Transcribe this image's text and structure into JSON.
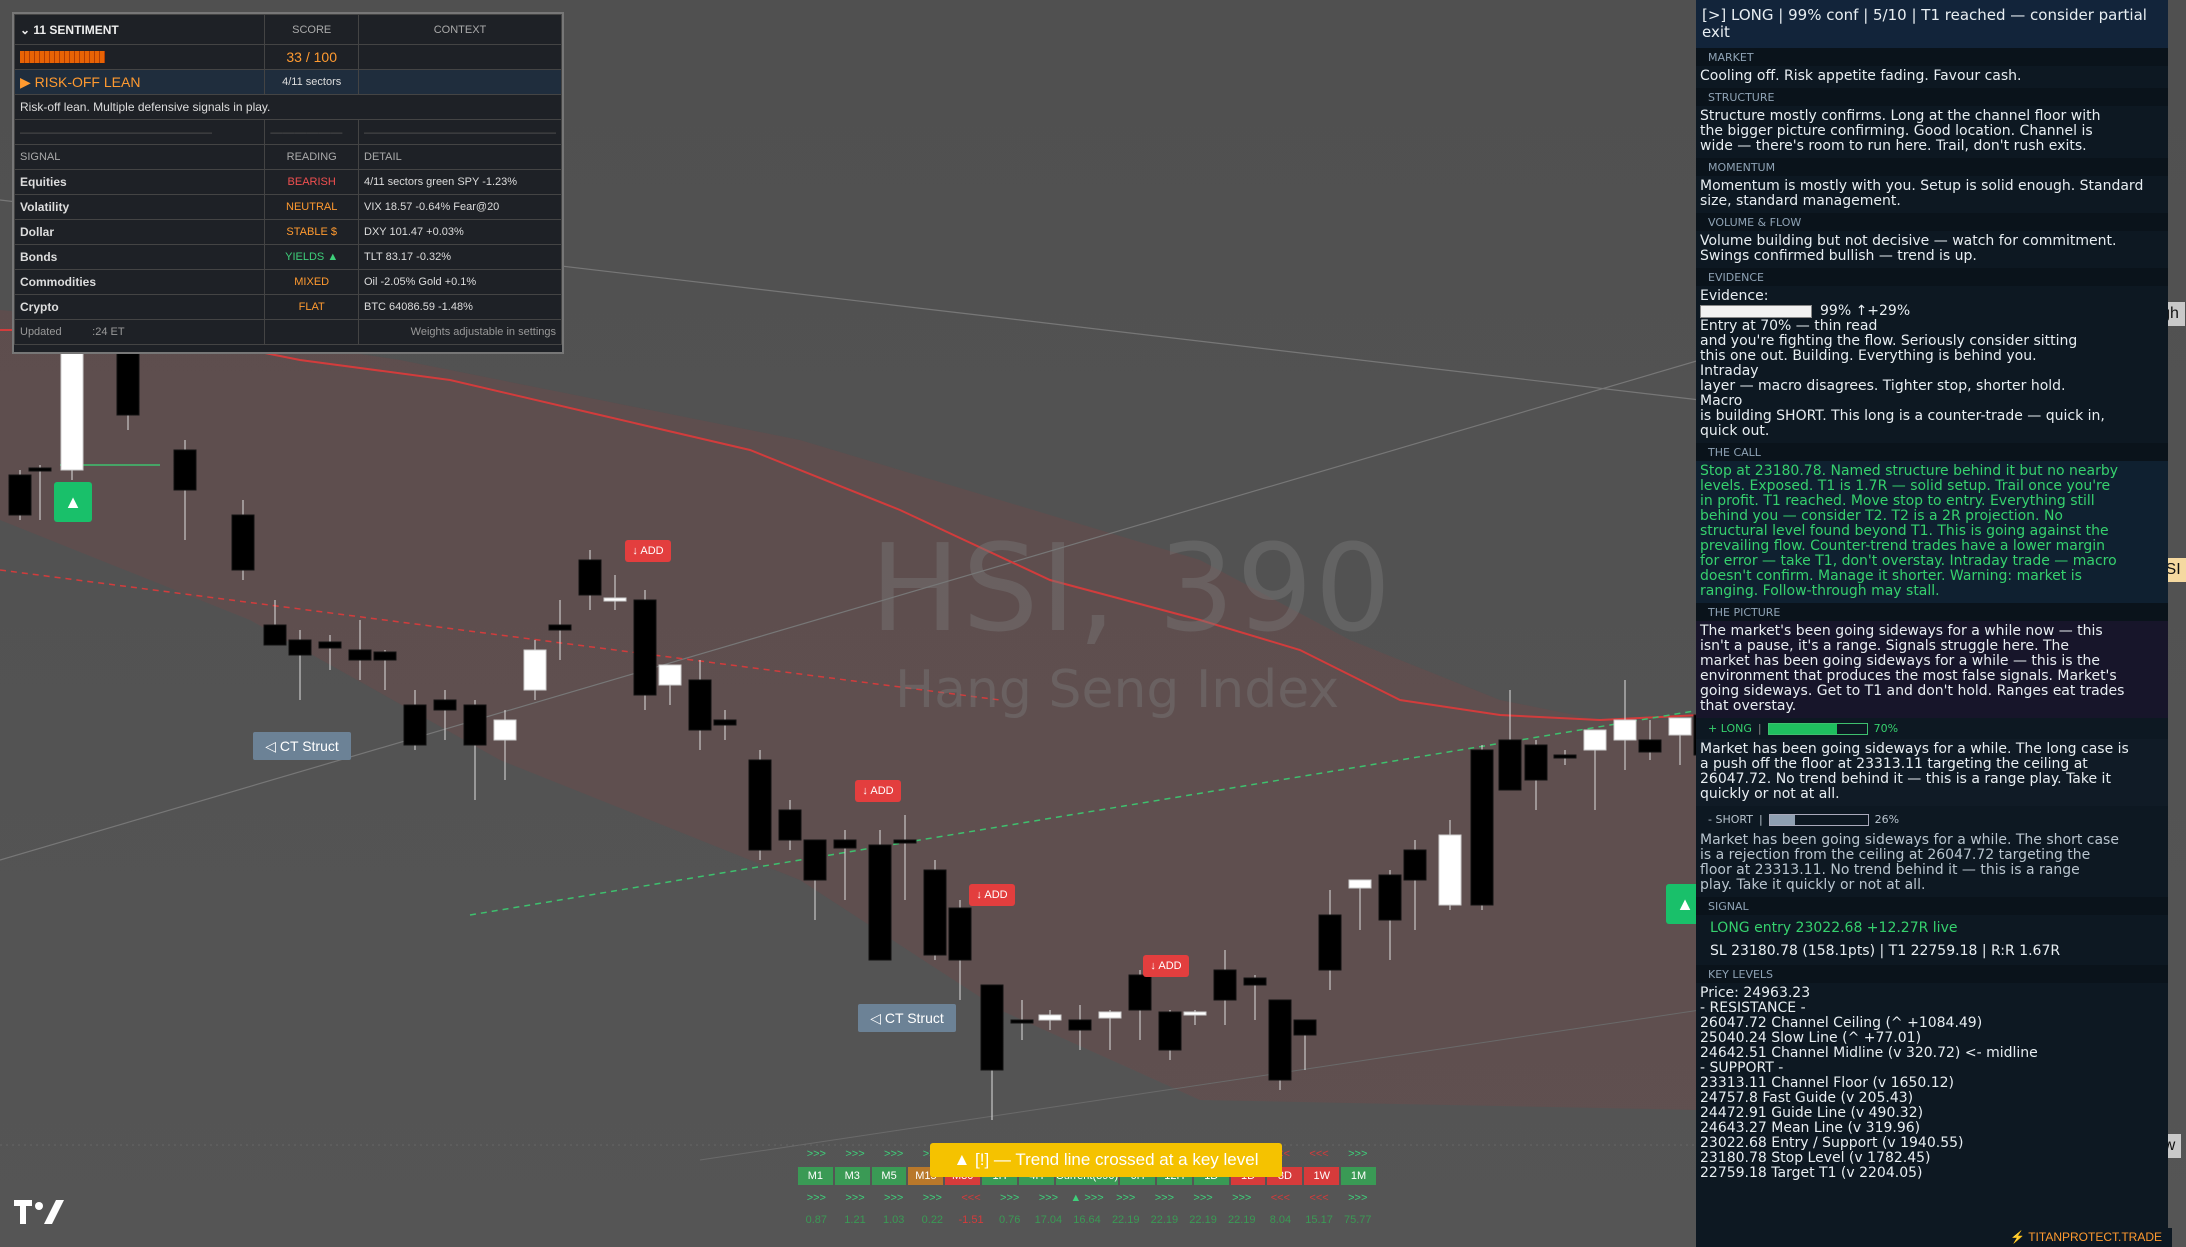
{
  "chart": {
    "symbol": "HSI, 390",
    "name": "Hang Seng Index",
    "candles": [
      [
        20,
        470,
        520,
        475,
        515
      ],
      [
        40,
        465,
        520,
        468,
        470
      ],
      [
        72,
        330,
        480,
        470,
        315
      ],
      [
        128,
        330,
        430,
        330,
        415
      ],
      [
        185,
        440,
        540,
        450,
        490
      ],
      [
        243,
        500,
        580,
        515,
        570
      ],
      [
        275,
        600,
        640,
        625,
        645
      ],
      [
        300,
        630,
        700,
        640,
        655
      ],
      [
        330,
        635,
        670,
        642,
        648
      ],
      [
        360,
        620,
        680,
        650,
        660
      ],
      [
        385,
        650,
        690,
        652,
        660
      ],
      [
        415,
        690,
        750,
        705,
        745
      ],
      [
        445,
        690,
        740,
        700,
        710
      ],
      [
        475,
        700,
        800,
        705,
        745
      ],
      [
        505,
        710,
        780,
        740,
        720
      ],
      [
        535,
        640,
        700,
        690,
        650
      ],
      [
        560,
        600,
        660,
        625,
        630
      ],
      [
        590,
        550,
        610,
        560,
        595
      ],
      [
        615,
        575,
        610,
        600,
        598
      ],
      [
        645,
        590,
        710,
        600,
        695
      ],
      [
        670,
        665,
        705,
        685,
        665
      ],
      [
        700,
        660,
        750,
        680,
        730
      ],
      [
        725,
        710,
        740,
        720,
        725
      ],
      [
        760,
        750,
        860,
        760,
        850
      ],
      [
        790,
        800,
        850,
        810,
        840
      ],
      [
        815,
        840,
        920,
        840,
        880
      ],
      [
        845,
        830,
        900,
        840,
        848
      ],
      [
        880,
        830,
        960,
        845,
        960
      ],
      [
        905,
        815,
        900,
        840,
        842
      ],
      [
        935,
        860,
        960,
        870,
        955
      ],
      [
        960,
        900,
        1000,
        908,
        960
      ],
      [
        992,
        985,
        1120,
        985,
        1070
      ],
      [
        1022,
        1000,
        1040,
        1020,
        1022
      ],
      [
        1050,
        1010,
        1030,
        1020,
        1015
      ],
      [
        1080,
        1005,
        1050,
        1020,
        1030
      ],
      [
        1110,
        1010,
        1050,
        1018,
        1012
      ],
      [
        1140,
        970,
        1040,
        975,
        1010
      ],
      [
        1170,
        1010,
        1060,
        1012,
        1050
      ],
      [
        1195,
        1010,
        1025,
        1015,
        1012
      ],
      [
        1225,
        950,
        1025,
        970,
        1000
      ],
      [
        1255,
        975,
        1020,
        978,
        985
      ],
      [
        1280,
        1000,
        1090,
        1000,
        1080
      ],
      [
        1305,
        1020,
        1070,
        1020,
        1035
      ],
      [
        1330,
        890,
        990,
        915,
        970
      ],
      [
        1360,
        880,
        930,
        888,
        880
      ],
      [
        1390,
        870,
        960,
        875,
        920
      ],
      [
        1415,
        840,
        930,
        850,
        880
      ],
      [
        1450,
        820,
        910,
        905,
        835
      ],
      [
        1482,
        745,
        910,
        750,
        905
      ],
      [
        1510,
        690,
        790,
        740,
        790
      ],
      [
        1536,
        740,
        810,
        745,
        780
      ],
      [
        1565,
        750,
        765,
        755,
        757
      ],
      [
        1595,
        730,
        810,
        750,
        730
      ],
      [
        1625,
        680,
        770,
        740,
        720
      ],
      [
        1650,
        720,
        760,
        740,
        752
      ],
      [
        1680,
        725,
        765,
        735,
        718
      ],
      [
        1705,
        695,
        800,
        715,
        755
      ]
    ]
  },
  "sentiment": {
    "header": [
      "11",
      "SENTIMENT",
      "SCORE",
      "CONTEXT"
    ],
    "score": "33 / 100",
    "lean": "▶ RISK-OFF LEAN",
    "sectors": "4/11 sectors",
    "summary": "Risk-off lean. Multiple defensive signals in play.",
    "cols": [
      "SIGNAL",
      "READING",
      "DETAIL"
    ],
    "rows": [
      {
        "signal": "Equities",
        "reading": "BEARISH",
        "detail": "4/11 sectors green  SPY -1.23%",
        "cls": "c-red"
      },
      {
        "signal": "Volatility",
        "reading": "NEUTRAL",
        "detail": "VIX 18.57  -0.64%  Fear@20",
        "cls": "c-org"
      },
      {
        "signal": "Dollar",
        "reading": "STABLE $",
        "detail": "DXY 101.47  +0.03%",
        "cls": "c-org"
      },
      {
        "signal": "Bonds",
        "reading": "YIELDS ▲",
        "detail": "TLT 83.17  -0.32%",
        "cls": "c-grn"
      },
      {
        "signal": "Commodities",
        "reading": "MIXED",
        "detail": "Oil -2.05%  Gold +0.1%",
        "cls": "c-org"
      },
      {
        "signal": "Crypto",
        "reading": "FLAT",
        "detail": "BTC 64086.59  -1.48%",
        "cls": "c-org"
      }
    ],
    "updated": "Updated",
    "updated_time": ":24 ET",
    "weights_note": "Weights adjustable in settings"
  },
  "tags": {
    "add": "↓ ADD",
    "ct_struct": "◁ CT Struct",
    "up": "▲",
    "high": "High",
    "hsi": "HSI",
    "low": "Low",
    "alert": "▲ [!] — Trend line crossed at a key level"
  },
  "mtf": {
    "arrows1": [
      ">>>",
      ">>>",
      ">>>",
      ">>>",
      ">>>",
      ">>>",
      ">>>",
      ">>>",
      ">>>",
      ">>>",
      ">>>",
      ">>>",
      "<<<",
      "<<<",
      ">>>"
    ],
    "labels": [
      "M1",
      "M3",
      "M5",
      "M15",
      "M30",
      "1H",
      "4H",
      "Current(390)",
      "6H",
      "12H",
      "1D",
      "1D",
      "3D",
      "1W",
      "1M"
    ],
    "arrows2": [
      ">>>",
      ">>>",
      ">>>",
      ">>>",
      "<<<",
      ">>>",
      ">>>",
      "▲ >>>",
      ">>>",
      ">>>",
      ">>>",
      ">>>",
      "<<<",
      "<<<",
      ">>>"
    ],
    "values": [
      "0.87",
      "1.21",
      "1.03",
      "0.22",
      "-1.51",
      "0.76",
      "17.04",
      "16.64",
      "22.19",
      "22.19",
      "22.19",
      "22.19",
      "8.04",
      "15.17",
      "75.77"
    ]
  },
  "panel": {
    "top": "[>]  LONG   |  99% conf   |  5/10   |  T1 reached — consider partial exit",
    "t_market": "MARKET",
    "market": "Cooling off. Risk appetite fading. Favour cash.",
    "t_structure": "STRUCTURE",
    "structure": "Structure mostly confirms. Long at the channel floor with\nthe bigger picture confirming. Good location. Channel is\nwide — there's room to run here. Trail, don't rush exits.",
    "t_momentum": "MOMENTUM",
    "momentum": "Momentum is mostly with you. Setup is solid enough. Standard\nsize, standard management.",
    "t_volume": "VOLUME & FLOW",
    "volume": "Volume building but not decisive — watch for commitment.\nSwings confirmed bullish — trend is up.",
    "t_evidence": "EVIDENCE",
    "evidence_label": "Evidence:",
    "evidence_val": "99% ↑+29%",
    "evidence": "Entry at 70% — thin read\nand you're fighting the flow. Seriously consider sitting\nthis one out.  Building. Everything is behind you.\nIntraday\nlayer — macro disagrees. Tighter stop, shorter hold.\nMacro\nis building SHORT. This long is a counter-trade — quick in,\nquick out.",
    "t_call": "THE CALL",
    "call": "Stop at 23180.78. Named structure behind it but no nearby\nlevels. Exposed. T1 is 1.7R — solid setup. Trail once you're\nin profit. T1 reached. Move stop to entry. Everything still\nbehind you — consider T2. T2 is a 2R projection. No\nstructural level found beyond T1. This is going against the\nprevailing flow. Counter-trend trades have a lower margin\nfor error — take T1, don't overstay. Intraday trade — macro\ndoesn't confirm. Manage it shorter. Warning: market is\nranging. Follow-through may stall.",
    "t_picture": "THE PICTURE",
    "picture": "The market's been going sideways for a while now — this\nisn't a pause, it's a range. Signals struggle here. The\nmarket has been going sideways for a while — this is the\nenvironment that produces the most false signals. Market's\ngoing sideways. Get to T1 and don't hold. Ranges eat trades\nthat overstay.",
    "long_lbl": "+ LONG",
    "long_pct": "70%",
    "long_text": "  Market has been going sideways for a while. The long case is\na push off the floor at 23313.11 targeting the ceiling at\n26047.72. No trend behind it — this is a range play. Take it\nquickly or not at all.",
    "short_lbl": "- SHORT",
    "short_pct": "26%",
    "short_text": "  Market has been going sideways for a while. The short case\nis a rejection from the ceiling at 26047.72 targeting the\nfloor at 23313.11. No trend behind it — this is a range\nplay. Take it quickly or not at all.",
    "t_signal": "SIGNAL",
    "signal1": "LONG  entry 23022.68  +12.27R live",
    "signal2": "SL 23180.78 (158.1pts)  |  T1 22759.18  |  R:R 1.67R",
    "t_levels": "KEY LEVELS",
    "levels": "Price: 24963.23\n -  RESISTANCE  -\n26047.72  Channel Ceiling  (^ +1084.49)\n25040.24  Slow Line  (^ +77.01)\n24642.51  Channel Midline  (v 320.72)  <- midline\n -  SUPPORT  -\n23313.11  Channel Floor  (v 1650.12)\n24757.8  Fast Guide  (v 205.43)\n24472.91  Guide Line  (v 490.32)\n24643.27  Mean Line  (v 319.96)\n23022.68  Entry / Support  (v 1940.55)\n23180.78  Stop Level  (v 1782.45)\n22759.18  Target T1  (v 2204.05)",
    "brand": "⚡ TITANPROTECT.TRADE"
  }
}
